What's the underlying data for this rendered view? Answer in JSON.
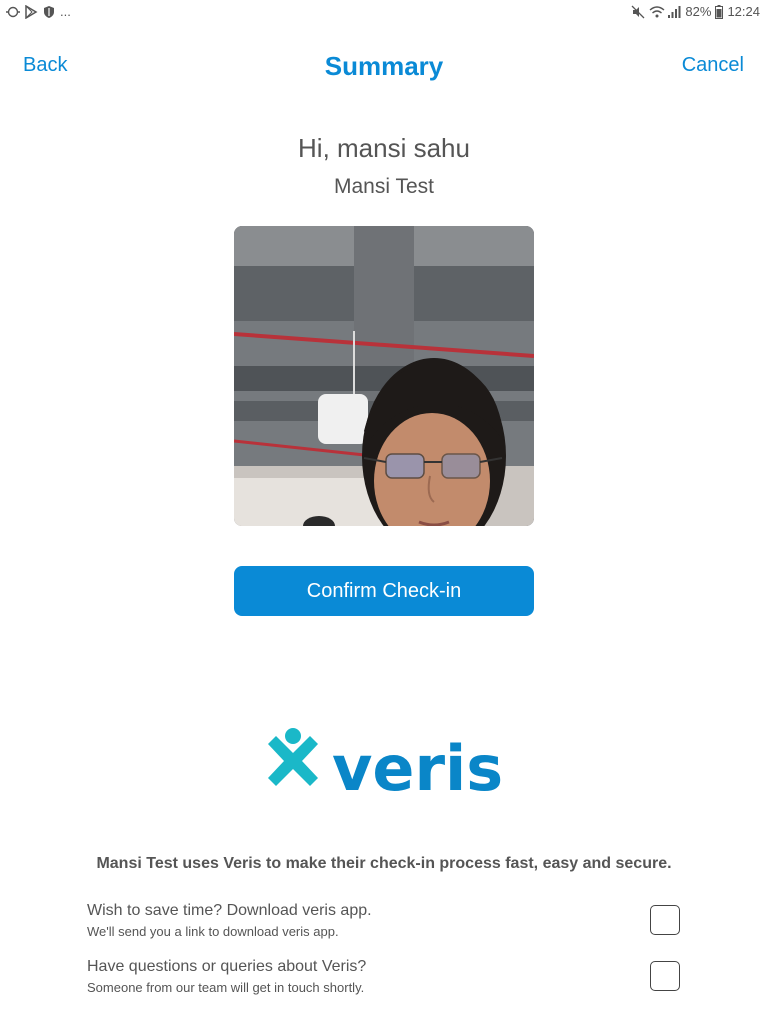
{
  "status_bar": {
    "left_icons": [
      "notification-icon",
      "play-store-icon",
      "shield-icon"
    ],
    "more": "...",
    "battery": "82%",
    "time": "12:24",
    "right_icons": [
      "mute-icon",
      "wifi-icon",
      "signal-icon",
      "battery-icon"
    ]
  },
  "header": {
    "back_label": "Back",
    "title": "Summary",
    "cancel_label": "Cancel"
  },
  "greeting": "Hi, mansi  sahu",
  "company": "Mansi Test",
  "confirm_label": "Confirm Check-in",
  "logo_text": "veris",
  "info_text": "Mansi Test uses Veris to make their check-in process fast, easy and secure.",
  "options": [
    {
      "title": "Wish to save time? Download veris app.",
      "subtitle": "We'll send you a link to download veris app.",
      "checked": false
    },
    {
      "title": "Have questions or queries about Veris?",
      "subtitle": "Someone from our team will get in touch shortly.",
      "checked": false
    }
  ],
  "colors": {
    "accent": "#0a8ad6",
    "text": "#555555",
    "logo_teal": "#1ab8c8",
    "logo_blue": "#0a86c8"
  }
}
